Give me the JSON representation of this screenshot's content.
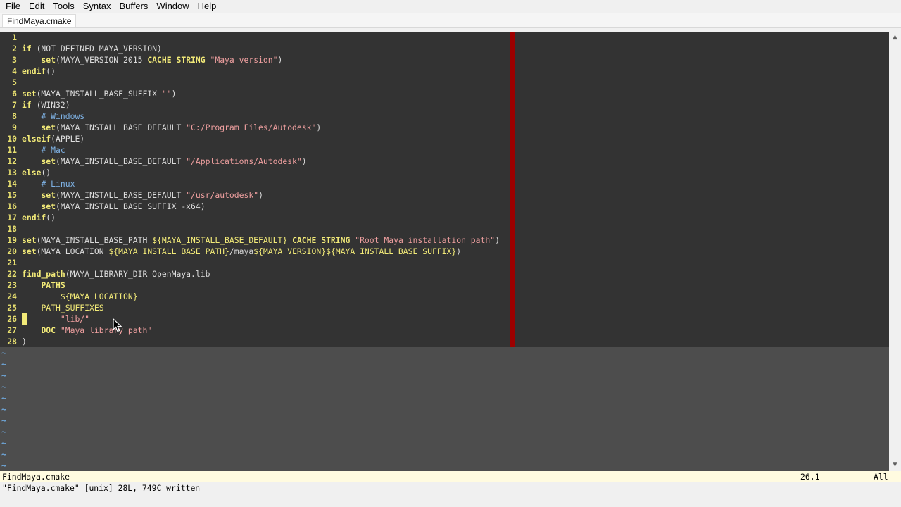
{
  "menu": {
    "items": [
      {
        "label": "File"
      },
      {
        "label": "Edit"
      },
      {
        "label": "Tools"
      },
      {
        "label": "Syntax"
      },
      {
        "label": "Buffers"
      },
      {
        "label": "Window"
      },
      {
        "label": "Help"
      }
    ]
  },
  "tabs": [
    {
      "label": "FindMaya.cmake",
      "active": true
    }
  ],
  "editor": {
    "colors": {
      "background": "#333333",
      "empty_area": "#4d4d4d",
      "color_column": "#9d0000",
      "line_number": "#e8e070",
      "keyword": "#f2ea78",
      "string": "#f0a0a0",
      "comment": "#7fb3e6",
      "tilde": "#6fa8dc"
    },
    "lines": [
      {
        "n": "1",
        "tokens": []
      },
      {
        "n": "2",
        "tokens": [
          [
            "kw",
            "if"
          ],
          [
            "txt",
            " (NOT DEFINED MAYA_VERSION)"
          ]
        ]
      },
      {
        "n": "3",
        "tokens": [
          [
            "txt",
            "    "
          ],
          [
            "kw",
            "set"
          ],
          [
            "txt",
            "(MAYA_VERSION 2015 "
          ],
          [
            "kw",
            "CACHE STRING"
          ],
          [
            "txt",
            " "
          ],
          [
            "str",
            "\"Maya version\""
          ],
          [
            "txt",
            ")"
          ]
        ]
      },
      {
        "n": "4",
        "tokens": [
          [
            "kw",
            "endif"
          ],
          [
            "txt",
            "()"
          ]
        ]
      },
      {
        "n": "5",
        "tokens": []
      },
      {
        "n": "6",
        "tokens": [
          [
            "kw",
            "set"
          ],
          [
            "txt",
            "(MAYA_INSTALL_BASE_SUFFIX "
          ],
          [
            "str",
            "\"\""
          ],
          [
            "txt",
            ")"
          ]
        ]
      },
      {
        "n": "7",
        "tokens": [
          [
            "kw",
            "if"
          ],
          [
            "txt",
            " (WIN32)"
          ]
        ]
      },
      {
        "n": "8",
        "tokens": [
          [
            "txt",
            "    "
          ],
          [
            "cmt",
            "# Windows"
          ]
        ]
      },
      {
        "n": "9",
        "tokens": [
          [
            "txt",
            "    "
          ],
          [
            "kw",
            "set"
          ],
          [
            "txt",
            "(MAYA_INSTALL_BASE_DEFAULT "
          ],
          [
            "str",
            "\"C:/Program Files/Autodesk\""
          ],
          [
            "txt",
            ")"
          ]
        ]
      },
      {
        "n": "10",
        "tokens": [
          [
            "kw",
            "elseif"
          ],
          [
            "txt",
            "(APPLE)"
          ]
        ]
      },
      {
        "n": "11",
        "tokens": [
          [
            "txt",
            "    "
          ],
          [
            "cmt",
            "# Mac"
          ]
        ]
      },
      {
        "n": "12",
        "tokens": [
          [
            "txt",
            "    "
          ],
          [
            "kw",
            "set"
          ],
          [
            "txt",
            "(MAYA_INSTALL_BASE_DEFAULT "
          ],
          [
            "str",
            "\"/Applications/Autodesk\""
          ],
          [
            "txt",
            ")"
          ]
        ]
      },
      {
        "n": "13",
        "tokens": [
          [
            "kw",
            "else"
          ],
          [
            "txt",
            "()"
          ]
        ]
      },
      {
        "n": "14",
        "tokens": [
          [
            "txt",
            "    "
          ],
          [
            "cmt",
            "# Linux"
          ]
        ]
      },
      {
        "n": "15",
        "tokens": [
          [
            "txt",
            "    "
          ],
          [
            "kw",
            "set"
          ],
          [
            "txt",
            "(MAYA_INSTALL_BASE_DEFAULT "
          ],
          [
            "str",
            "\"/usr/autodesk\""
          ],
          [
            "txt",
            ")"
          ]
        ]
      },
      {
        "n": "16",
        "tokens": [
          [
            "txt",
            "    "
          ],
          [
            "kw",
            "set"
          ],
          [
            "txt",
            "(MAYA_INSTALL_BASE_SUFFIX -x64)"
          ]
        ]
      },
      {
        "n": "17",
        "tokens": [
          [
            "kw",
            "endif"
          ],
          [
            "txt",
            "()"
          ]
        ]
      },
      {
        "n": "18",
        "tokens": []
      },
      {
        "n": "19",
        "tokens": [
          [
            "kw",
            "set"
          ],
          [
            "txt",
            "(MAYA_INSTALL_BASE_PATH "
          ],
          [
            "var",
            "${MAYA_INSTALL_BASE_DEFAULT}"
          ],
          [
            "txt",
            " "
          ],
          [
            "kw",
            "CACHE STRING"
          ],
          [
            "txt",
            " "
          ],
          [
            "str",
            "\"Root Maya installation path\""
          ],
          [
            "txt",
            ")"
          ]
        ]
      },
      {
        "n": "20",
        "tokens": [
          [
            "kw",
            "set"
          ],
          [
            "txt",
            "(MAYA_LOCATION "
          ],
          [
            "var",
            "${MAYA_INSTALL_BASE_PATH}"
          ],
          [
            "txt",
            "/maya"
          ],
          [
            "var",
            "${MAYA_VERSION}${MAYA_INSTALL_BASE_SUFFIX}"
          ],
          [
            "txt",
            ")"
          ]
        ]
      },
      {
        "n": "21",
        "tokens": []
      },
      {
        "n": "22",
        "tokens": [
          [
            "kw",
            "find_path"
          ],
          [
            "txt",
            "(MAYA_LIBRARY_DIR OpenMaya.lib"
          ]
        ]
      },
      {
        "n": "23",
        "tokens": [
          [
            "txt",
            "    "
          ],
          [
            "kw",
            "PATHS"
          ]
        ]
      },
      {
        "n": "24",
        "tokens": [
          [
            "txt",
            "        "
          ],
          [
            "var",
            "${MAYA_LOCATION}"
          ]
        ]
      },
      {
        "n": "25",
        "tokens": [
          [
            "txt",
            "    "
          ],
          [
            "var",
            "PATH_SUFFIXES"
          ]
        ]
      },
      {
        "n": "26",
        "tokens": [
          [
            "txt",
            "        "
          ],
          [
            "str",
            "\"lib/\""
          ]
        ]
      },
      {
        "n": "27",
        "tokens": [
          [
            "txt",
            "    "
          ],
          [
            "kw",
            "DOC"
          ],
          [
            "txt",
            " "
          ],
          [
            "str",
            "\"Maya library path\""
          ]
        ]
      },
      {
        "n": "28",
        "tokens": [
          [
            "txt",
            ")"
          ]
        ]
      }
    ],
    "tilde_count": 11,
    "tilde_char": "~"
  },
  "statusline": {
    "filename": "FindMaya.cmake",
    "position": "26,1",
    "scroll": "All",
    "background": "#fffbe0"
  },
  "cmdline": {
    "message": "\"FindMaya.cmake\" [unix] 28L, 749C written"
  },
  "icons": {
    "scroll_up": "chevron-up-icon",
    "scroll_down": "chevron-down-icon",
    "pointer": "mouse-pointer-icon"
  }
}
